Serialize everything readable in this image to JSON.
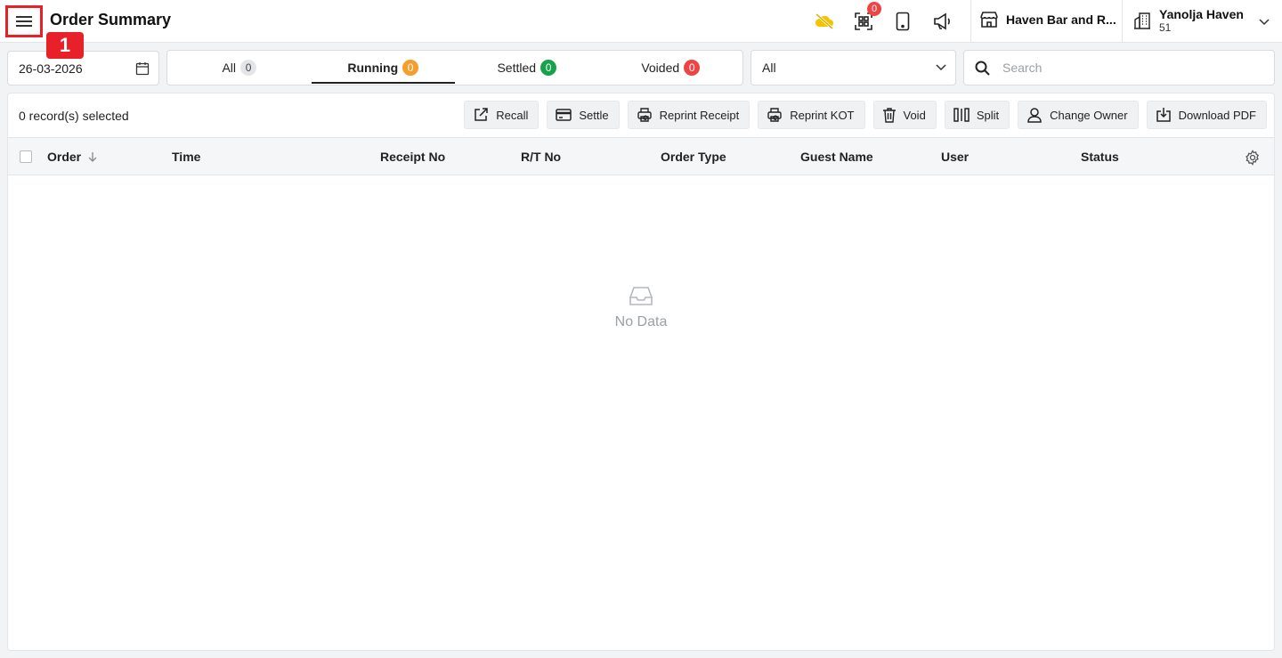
{
  "header": {
    "title": "Order Summary",
    "step_marker": "1",
    "notification_count": "0",
    "outlet_name": "Haven Bar and R...",
    "property_name": "Yanolja Haven",
    "property_number": "51",
    "icons": [
      "menu-icon",
      "cloud-off-icon",
      "qr-scan-icon",
      "tablet-icon",
      "megaphone-icon",
      "store-icon",
      "building-icon",
      "chevron-down-icon"
    ]
  },
  "filters": {
    "date": "26-03-2026",
    "tabs": [
      {
        "label": "All",
        "count": "0",
        "color": "#e3e5e8"
      },
      {
        "label": "Running",
        "count": "0",
        "color": "#f59e2b"
      },
      {
        "label": "Settled",
        "count": "0",
        "color": "#16a34a"
      },
      {
        "label": "Voided",
        "count": "0",
        "color": "#ef4444"
      }
    ],
    "active_tab": "Running",
    "select_value": "All",
    "search_placeholder": "Search"
  },
  "toolbar": {
    "selected_text": "0 record(s) selected",
    "actions": [
      {
        "label": "Recall",
        "icon": "external-link-icon"
      },
      {
        "label": "Settle",
        "icon": "card-icon"
      },
      {
        "label": "Reprint Receipt",
        "icon": "printer-refresh-icon"
      },
      {
        "label": "Reprint KOT",
        "icon": "printer-refresh-icon"
      },
      {
        "label": "Void",
        "icon": "trash-icon"
      },
      {
        "label": "Split",
        "icon": "split-icon"
      },
      {
        "label": "Change Owner",
        "icon": "user-icon"
      },
      {
        "label": "Download PDF",
        "icon": "download-icon"
      }
    ]
  },
  "table": {
    "columns": [
      "Order",
      "Time",
      "Receipt No",
      "R/T No",
      "Order Type",
      "Guest Name",
      "User",
      "Status"
    ],
    "rows": [],
    "empty_text": "No Data"
  }
}
